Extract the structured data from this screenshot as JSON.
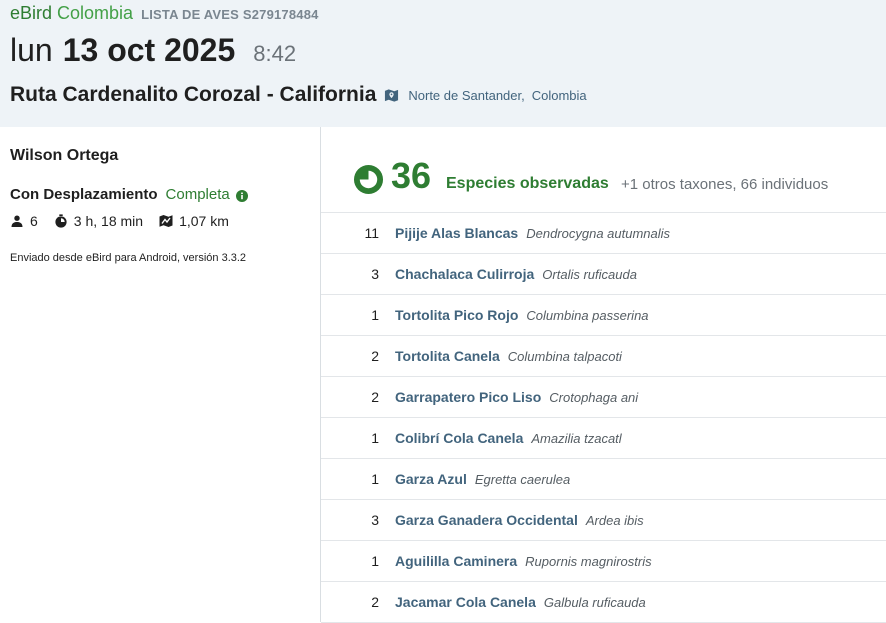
{
  "header": {
    "brand": "eBird",
    "portal": "Colombia",
    "checklist_label": "LISTA DE AVES S279178484",
    "weekday": "lun",
    "date": "13 oct 2025",
    "time": "8:42",
    "location_name": "Ruta Cardenalito Corozal - California",
    "region": "Norte de Santander,",
    "country": "Colombia"
  },
  "details": {
    "observer": "Wilson Ortega",
    "protocol": "Con Desplazamiento",
    "status": "Completa",
    "observers_count": "6",
    "duration": "3 h, 18 min",
    "distance": "1,07 km",
    "submitted_from": "Enviado desde eBird para Android, versión 3.3.2"
  },
  "summary": {
    "species_count": "36",
    "species_label": "Especies observadas",
    "extra": "+1 otros taxones, 66 individuos"
  },
  "observations": [
    {
      "count": "11",
      "common": "Pijije Alas Blancas",
      "scientific": "Dendrocygna autumnalis"
    },
    {
      "count": "3",
      "common": "Chachalaca Culirroja",
      "scientific": "Ortalis ruficauda"
    },
    {
      "count": "1",
      "common": "Tortolita Pico Rojo",
      "scientific": "Columbina passerina"
    },
    {
      "count": "2",
      "common": "Tortolita Canela",
      "scientific": "Columbina talpacoti"
    },
    {
      "count": "2",
      "common": "Garrapatero Pico Liso",
      "scientific": "Crotophaga ani"
    },
    {
      "count": "1",
      "common": "Colibrí Cola Canela",
      "scientific": "Amazilia tzacatl"
    },
    {
      "count": "1",
      "common": "Garza Azul",
      "scientific": "Egretta caerulea"
    },
    {
      "count": "3",
      "common": "Garza Ganadera Occidental",
      "scientific": "Ardea ibis"
    },
    {
      "count": "1",
      "common": "Aguililla Caminera",
      "scientific": "Rupornis magnirostris"
    },
    {
      "count": "2",
      "common": "Jacamar Cola Canela",
      "scientific": "Galbula ruficauda"
    }
  ],
  "icons": {
    "map": "map-icon",
    "info": "info-icon",
    "observers": "person-icon",
    "duration": "stopwatch-icon",
    "distance": "route-icon",
    "species": "species-circle-icon"
  },
  "colors": {
    "brand_green": "#2e7d32",
    "link_blue": "#42647d",
    "header_bg": "#eef3f7"
  }
}
